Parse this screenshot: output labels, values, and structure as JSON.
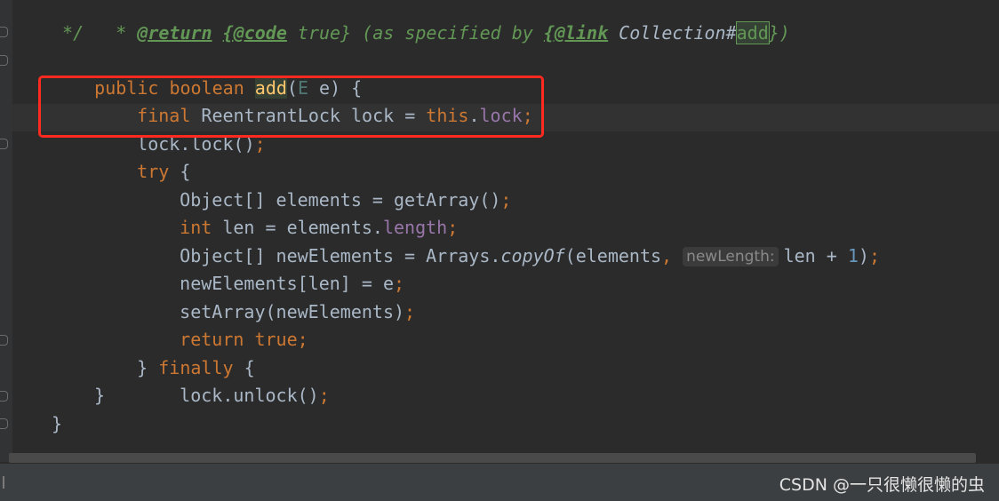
{
  "code": {
    "doc_line": {
      "star": " * ",
      "return_tag": "@return",
      "sp1": " ",
      "code_tag": "{@code",
      "true_text": " true} (as specified by ",
      "link_tag": "{@link",
      "collection_text": " Collection#",
      "add_ref": "add",
      "close": "})"
    },
    "doc_end": " */",
    "l1": {
      "public": "public",
      "boolean": " boolean ",
      "name": "add",
      "paren_open": "(",
      "type_param": "E",
      "param": " e) {"
    },
    "l2": {
      "final": "final",
      "decl": " ReentrantLock lock = ",
      "this": "this",
      "dot": ".",
      "field": "lock",
      "semi": ";"
    },
    "l3": {
      "text": "lock.lock()",
      "semi": ";"
    },
    "l4": {
      "try": "try",
      "rest": " {"
    },
    "l5": {
      "text": "Object[] elements = getArray()",
      "semi": ";"
    },
    "l6": {
      "int": "int",
      "mid": " len = elements.",
      "length": "length",
      "semi": ";"
    },
    "l7": {
      "pre": "Object[] newElements = Arrays.",
      "method": "copyOf",
      "args": "(elements",
      "comma": ",",
      "hint": "newLength:",
      "len": "len + ",
      "one": "1",
      "close": ")",
      "semi": ";"
    },
    "l8": {
      "text": "newElements[len] = e",
      "semi": ";"
    },
    "l9": {
      "text": "setArray(newElements)",
      "semi": ";"
    },
    "l10": {
      "return": "return",
      "true": " true",
      "semi": ";"
    },
    "l11": {
      "brace": "} ",
      "finally": "finally",
      "rest": " {"
    },
    "l12": {
      "text": "lock.unlock()",
      "semi": ";"
    },
    "l13": "}",
    "l14": "}"
  },
  "watermark": "CSDN @一只很懒很懒的虫",
  "colors": {
    "background": "#2b2b2b",
    "keyword": "#cc7832",
    "field": "#9876aa",
    "number": "#6897bb",
    "doc_comment": "#629755",
    "highlight_box": "#ff2a1f"
  }
}
